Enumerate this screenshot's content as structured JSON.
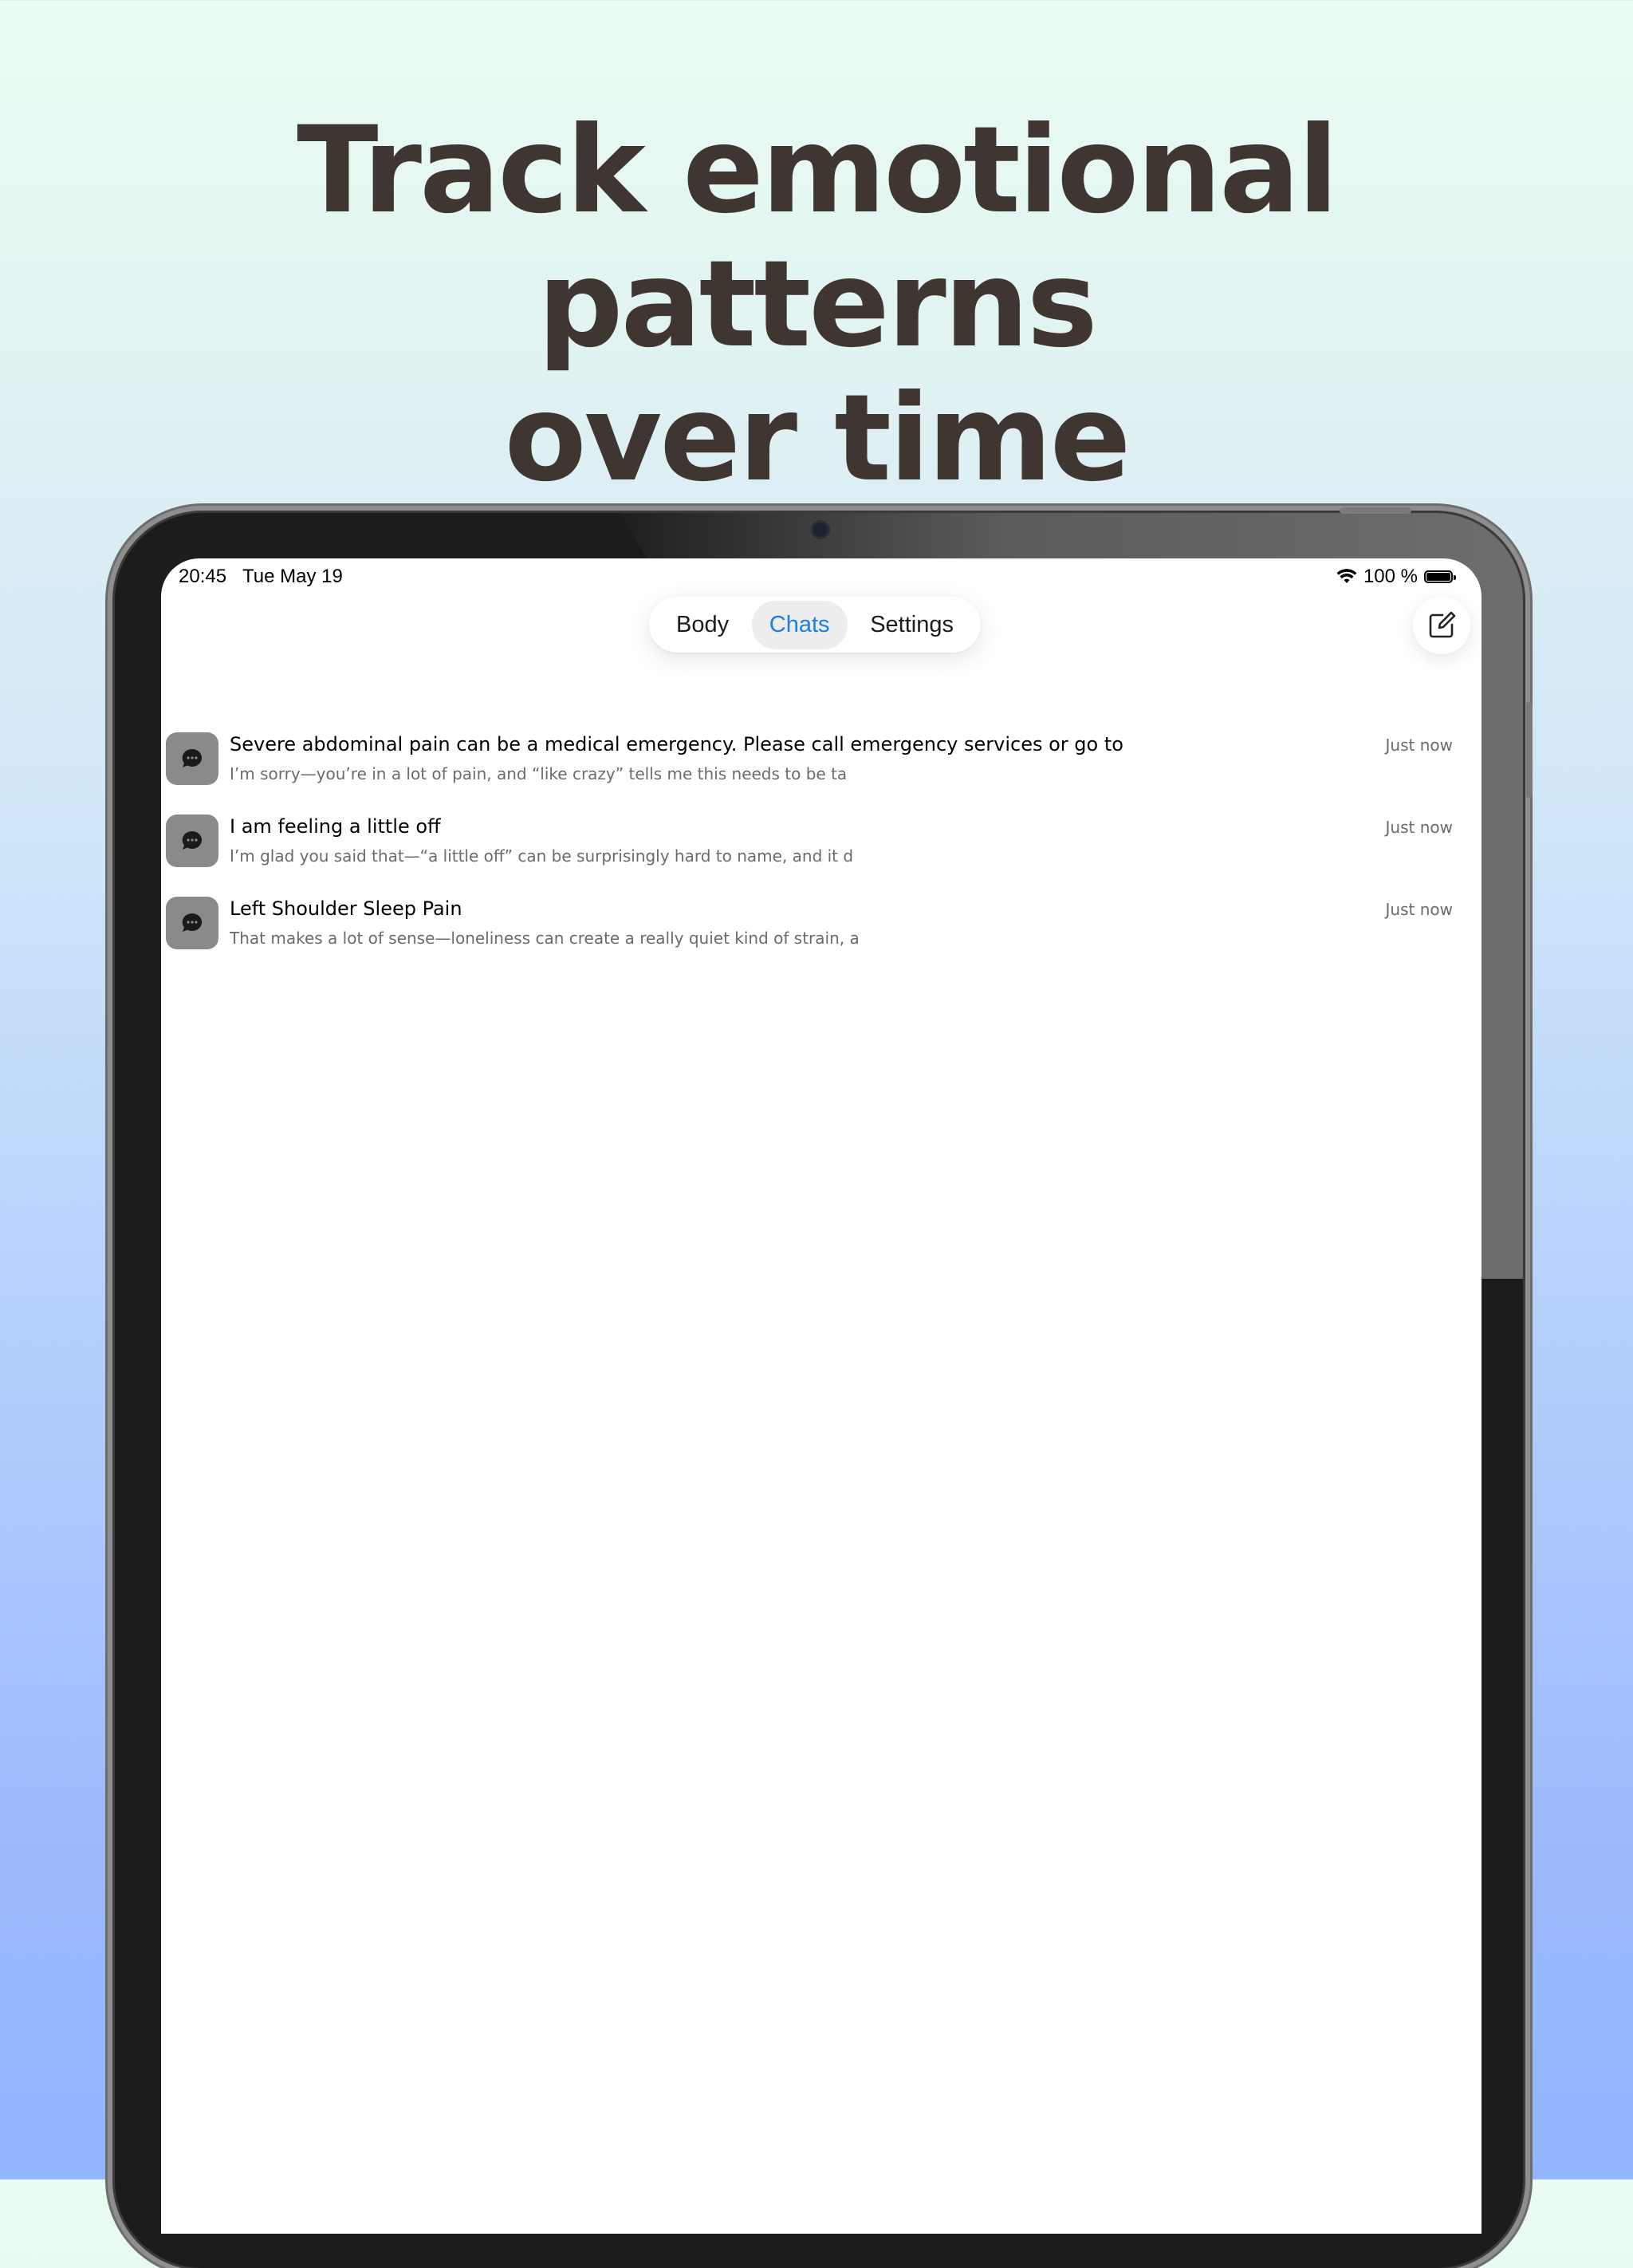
{
  "headline": {
    "line1": "Track emotional patterns",
    "line2": "over time"
  },
  "status_bar": {
    "time": "20:45",
    "date": "Tue May 19",
    "battery": "100 %",
    "icons": [
      "wifi-icon",
      "battery-icon"
    ]
  },
  "tabs": [
    {
      "label": "Body",
      "active": false
    },
    {
      "label": "Chats",
      "active": true
    },
    {
      "label": "Settings",
      "active": false
    }
  ],
  "compose_icon": "compose-icon",
  "chat_icon": "chat-bubble-icon",
  "colors": {
    "accent": "#1a7fe0",
    "headline": "#3f3531",
    "avatar_bg": "#8a8a8a"
  },
  "chats": [
    {
      "title": "Severe abdominal pain can be a medical emergency. Please call emergency services or go to",
      "preview": "I’m sorry—you’re in a lot of pain, and “like crazy” tells me this needs to be ta",
      "time": "Just now"
    },
    {
      "title": "I am feeling a little off",
      "preview": "I’m glad you said that—“a little off” can be surprisingly hard to name, and it d",
      "time": "Just now"
    },
    {
      "title": "Left Shoulder Sleep Pain",
      "preview": "That makes a lot of sense—loneliness can create a really quiet kind of strain, a",
      "time": "Just now"
    }
  ]
}
